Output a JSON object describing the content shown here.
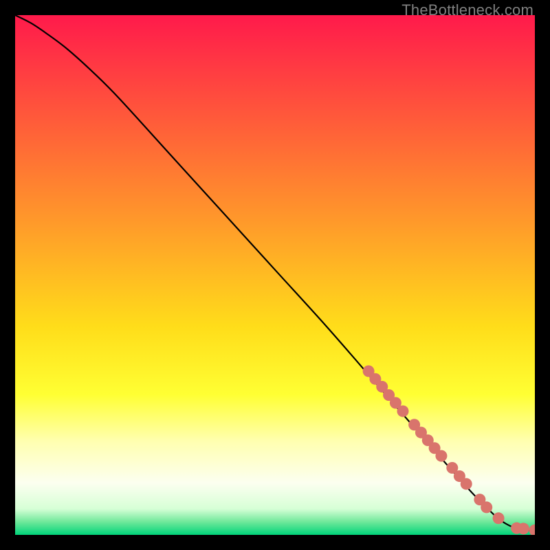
{
  "watermark": "TheBottleneck.com",
  "colors": {
    "background_black": "#000000",
    "line": "#000000",
    "marker_fill": "#d9746c",
    "marker_stroke": "#623d3d"
  },
  "chart_data": {
    "type": "line",
    "title": "",
    "xlabel": "",
    "ylabel": "",
    "xlim": [
      0,
      100
    ],
    "ylim": [
      0,
      100
    ],
    "gradient_stops": [
      {
        "offset": 0.0,
        "color": "#ff1a4b"
      },
      {
        "offset": 0.2,
        "color": "#ff5a3a"
      },
      {
        "offset": 0.4,
        "color": "#ff9a2a"
      },
      {
        "offset": 0.6,
        "color": "#ffdd1a"
      },
      {
        "offset": 0.73,
        "color": "#ffff33"
      },
      {
        "offset": 0.82,
        "color": "#ffffb0"
      },
      {
        "offset": 0.9,
        "color": "#fcfff0"
      },
      {
        "offset": 0.95,
        "color": "#d6ffd6"
      },
      {
        "offset": 0.975,
        "color": "#6fe89a"
      },
      {
        "offset": 1.0,
        "color": "#00d47a"
      }
    ],
    "series": [
      {
        "name": "curve",
        "x": [
          0,
          3,
          6,
          10,
          15,
          20,
          30,
          40,
          50,
          60,
          70,
          80,
          88,
          92,
          94,
          96,
          98,
          100
        ],
        "y": [
          100,
          98.5,
          96.5,
          93.5,
          89,
          84,
          73,
          62,
          51,
          40,
          28.5,
          17,
          8,
          4,
          2.4,
          1.4,
          0.9,
          0.9
        ]
      }
    ],
    "markers": [
      {
        "x": 68.0,
        "y": 31.5
      },
      {
        "x": 69.3,
        "y": 30.0
      },
      {
        "x": 70.6,
        "y": 28.5
      },
      {
        "x": 71.9,
        "y": 26.9
      },
      {
        "x": 73.2,
        "y": 25.4
      },
      {
        "x": 74.6,
        "y": 23.8
      },
      {
        "x": 76.8,
        "y": 21.2
      },
      {
        "x": 78.1,
        "y": 19.7
      },
      {
        "x": 79.4,
        "y": 18.2
      },
      {
        "x": 80.7,
        "y": 16.7
      },
      {
        "x": 82.0,
        "y": 15.2
      },
      {
        "x": 84.1,
        "y": 12.9
      },
      {
        "x": 85.5,
        "y": 11.3
      },
      {
        "x": 86.8,
        "y": 9.8
      },
      {
        "x": 89.4,
        "y": 6.8
      },
      {
        "x": 90.7,
        "y": 5.3
      },
      {
        "x": 93.0,
        "y": 3.2
      },
      {
        "x": 96.5,
        "y": 1.3
      },
      {
        "x": 97.8,
        "y": 1.2
      },
      {
        "x": 100.0,
        "y": 0.9
      }
    ]
  }
}
